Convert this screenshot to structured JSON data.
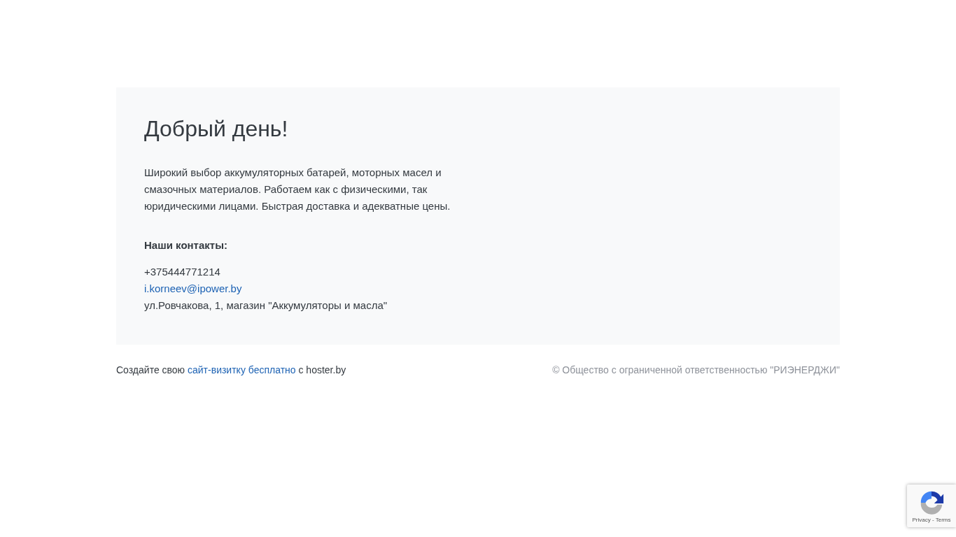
{
  "card": {
    "heading": "Добрый день!",
    "description": "Широкий выбор аккумуляторных батарей, моторных масел и смазочных материалов. Работаем как с физическими, так юридическими лицами. Быстрая доставка и адекватные цены.",
    "contacts_title": "Наши контакты:",
    "phone": "+375444771214",
    "email": "i.korneev@ipower.by",
    "address": "ул.Ровчакова, 1, магазин \"Аккумуляторы и масла\""
  },
  "footer": {
    "promo_before": "Создайте свою",
    "promo_link": "сайт-визитку бесплатно",
    "promo_after": "с hoster.by",
    "copyright": "© Общество с ограниченной ответственностью \"РИЭНЕРДЖИ\""
  },
  "recaptcha": {
    "links": "Privacy - Terms"
  }
}
